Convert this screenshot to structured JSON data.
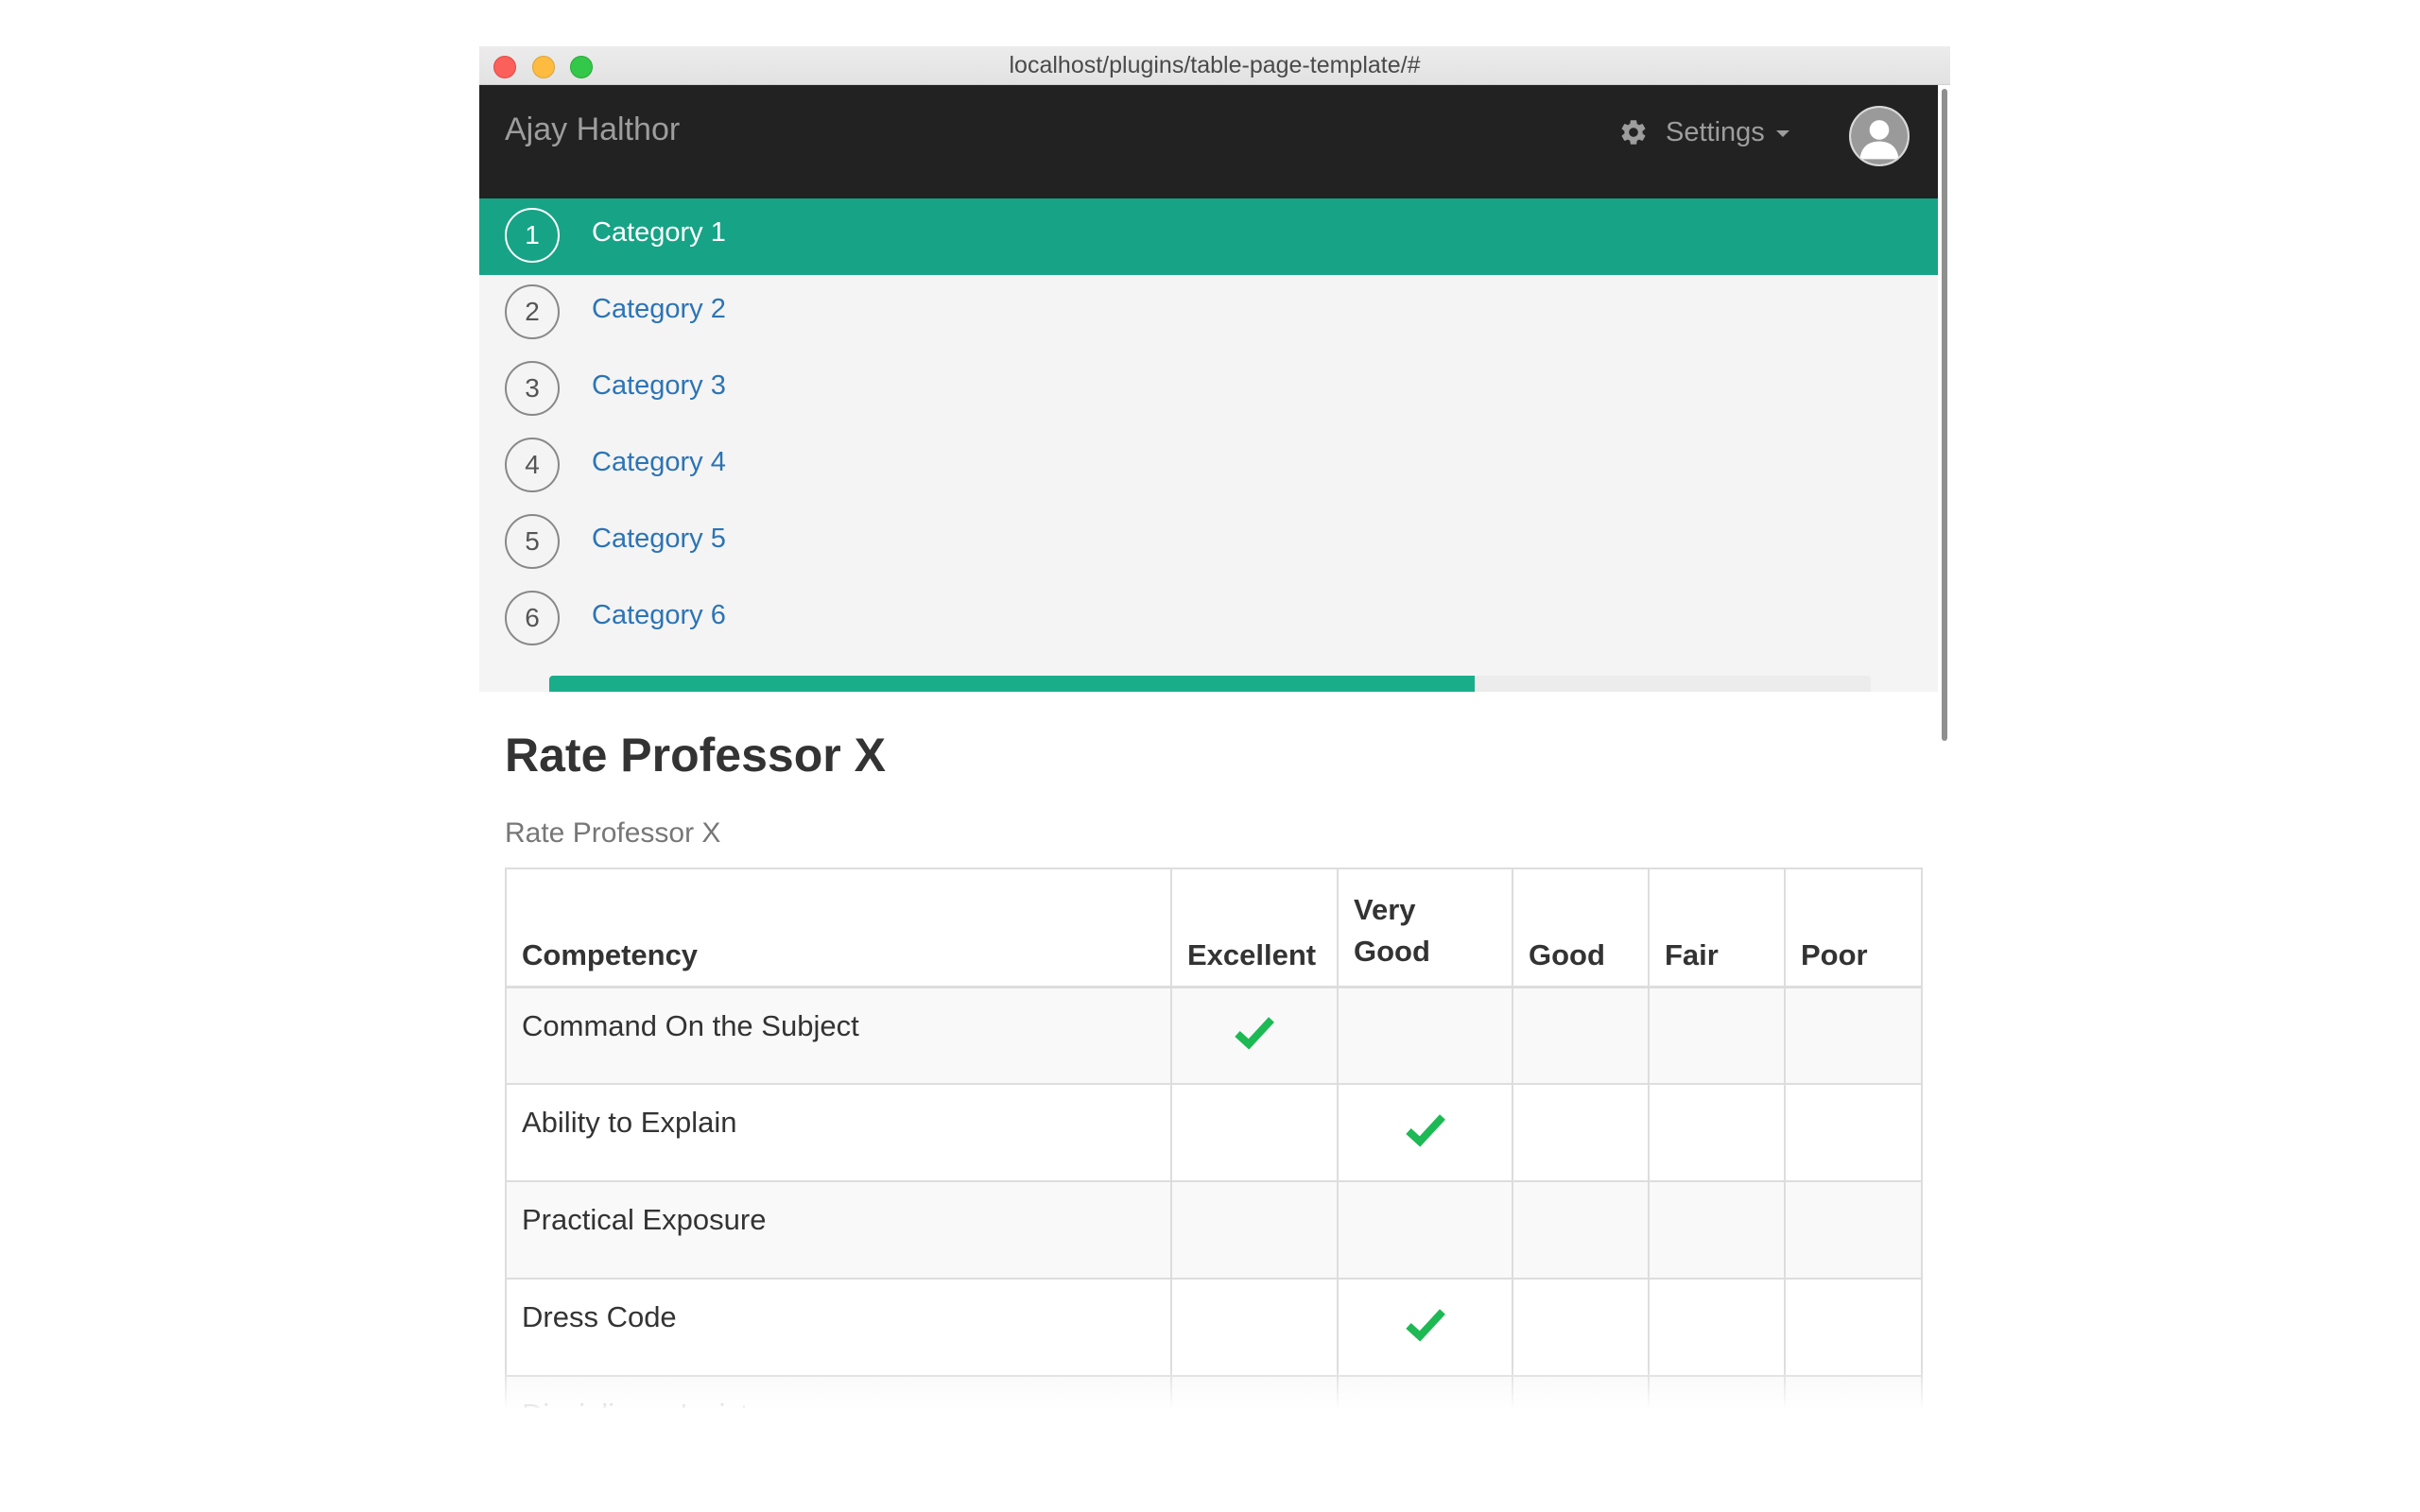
{
  "window": {
    "url": "localhost/plugins/table-page-template/#"
  },
  "navbar": {
    "brand": "Ajay Halthor",
    "settings_label": "Settings"
  },
  "steps": [
    {
      "number": "1",
      "label": "Category 1",
      "active": true
    },
    {
      "number": "2",
      "label": "Category 2",
      "active": false
    },
    {
      "number": "3",
      "label": "Category 3",
      "active": false
    },
    {
      "number": "4",
      "label": "Category 4",
      "active": false
    },
    {
      "number": "5",
      "label": "Category 5",
      "active": false
    },
    {
      "number": "6",
      "label": "Category 6",
      "active": false
    }
  ],
  "progress": {
    "fraction": 0.7
  },
  "main": {
    "title": "Rate Professor X",
    "subtitle": "Rate Professor X"
  },
  "table": {
    "headers": [
      "Competency",
      "Excellent",
      "Very Good",
      "Good",
      "Fair",
      "Poor"
    ],
    "rows": [
      {
        "competency": "Command On the Subject",
        "rating": "Excellent"
      },
      {
        "competency": "Ability to Explain",
        "rating": "Very Good"
      },
      {
        "competency": "Practical Exposure",
        "rating": ""
      },
      {
        "competency": "Dress Code",
        "rating": "Very Good"
      },
      {
        "competency": "Disciplinary Insistence",
        "rating": ""
      }
    ]
  },
  "colors": {
    "navbar_bg": "#222222",
    "accent": "#17a386",
    "link": "#2c74b5",
    "check": "#1db954"
  },
  "icons": {
    "settings": "gear-icon",
    "caret": "caret-down-icon",
    "avatar": "user-avatar-icon",
    "rating_mark": "checkmark-icon"
  }
}
